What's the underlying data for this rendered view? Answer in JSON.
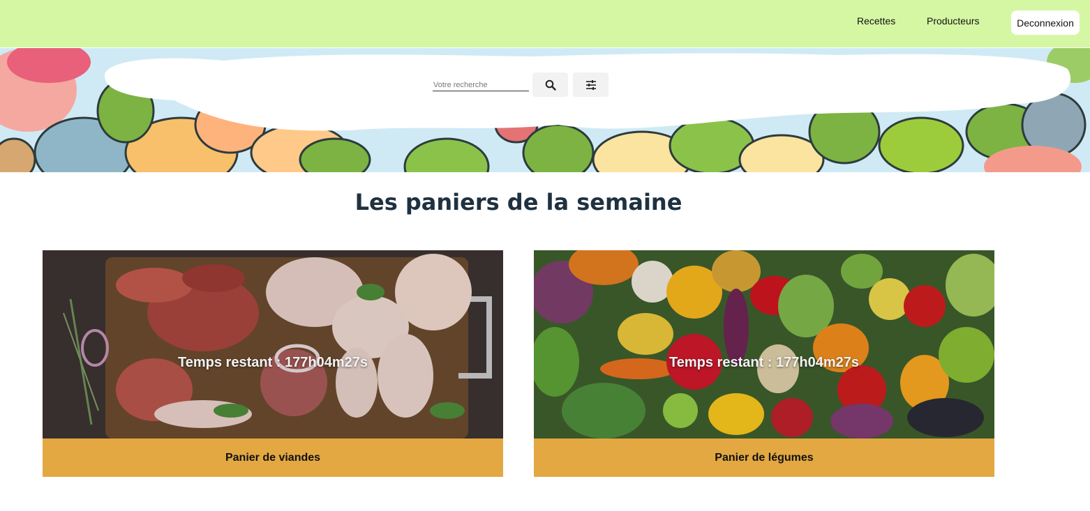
{
  "nav": {
    "links": [
      "Recettes",
      "Producteurs"
    ],
    "logout_label": "Deconnexion"
  },
  "search": {
    "placeholder": "Votre recherche",
    "search_icon": "search-icon",
    "filter_icon": "sliders-icon"
  },
  "section": {
    "title": "Les paniers de la semaine"
  },
  "baskets": [
    {
      "timer": "Temps restant : 177h04m27s",
      "label": "Panier de viandes"
    },
    {
      "timer": "Temps restant : 177h04m27s",
      "label": "Panier de légumes"
    }
  ],
  "colors": {
    "topbar": "#d5f7a3",
    "card_footer": "#e3a842",
    "title": "#1f3140"
  }
}
